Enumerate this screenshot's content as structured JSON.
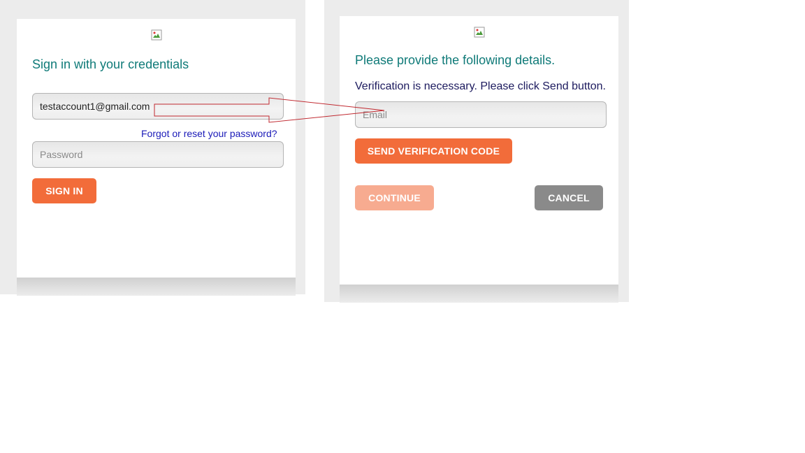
{
  "signin": {
    "heading": "Sign in with your credentials",
    "email_value": "testaccount1@gmail.com",
    "forgot_link": "Forgot or reset your password?",
    "password_placeholder": "Password",
    "signin_button": "SIGN IN",
    "logo_icon": "broken-image-icon"
  },
  "verify": {
    "heading": "Please provide the following details.",
    "instruction": "Verification is necessary. Please click Send button.",
    "email_placeholder": "Email",
    "send_button": "SEND VERIFICATION CODE",
    "continue_button": "CONTINUE",
    "cancel_button": "CANCEL",
    "logo_icon": "broken-image-icon"
  },
  "annotation": {
    "arrow_color": "#c0282f",
    "description_icon": "arrow-annotation-icon"
  },
  "colors": {
    "accent": "#f26c3a",
    "accent_faded": "#f7ab90",
    "heading": "#0f7a78",
    "link": "#1a1ab8",
    "cancel": "#8a8a8a"
  }
}
